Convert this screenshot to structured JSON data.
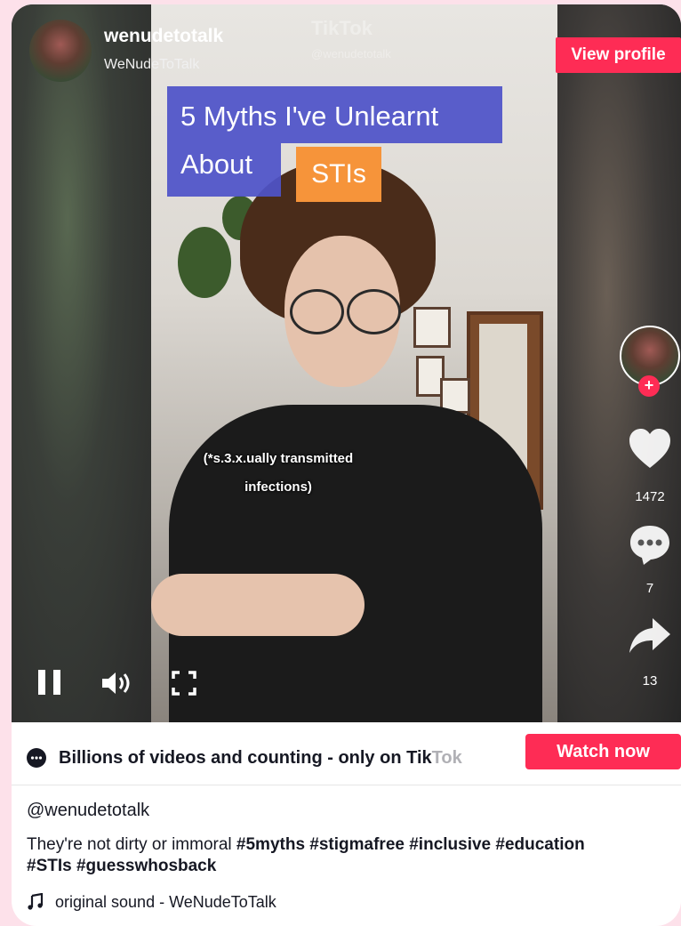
{
  "video": {
    "watermark_brand": "TikTok",
    "watermark_handle": "@wenudetotalk",
    "overlay_title_line1": "5 Myths I've Unlearnt",
    "overlay_title_line2": "About",
    "overlay_title_highlight": "STIs",
    "caption_line1": "(*s.3.x.ually transmitted",
    "caption_line2": "infections)",
    "state": "playing"
  },
  "author": {
    "username": "wenudetotalk",
    "display_name": "WeNudeToTalk",
    "view_profile_label": "View profile"
  },
  "actions": {
    "follow_symbol": "+",
    "likes": "1472",
    "comments": "7",
    "shares": "13"
  },
  "banner": {
    "text_main": "Billions of videos and counting - only on Tik",
    "text_faded": "Tok",
    "watch_now_label": "Watch now"
  },
  "description": {
    "handle": "@wenudetotalk",
    "text": "They're not dirty or immoral ",
    "hashtags_line1": "#5myths #stigmafree #inclusive #education",
    "hashtags_line2": "#STIs #guesswhosback"
  },
  "music": {
    "label": "original sound - WeNudeToTalk"
  },
  "colors": {
    "accent": "#fe2c55",
    "overlay_blue": "#4f53c8",
    "overlay_orange": "#f6943a",
    "page_background": "#fde1ea"
  }
}
